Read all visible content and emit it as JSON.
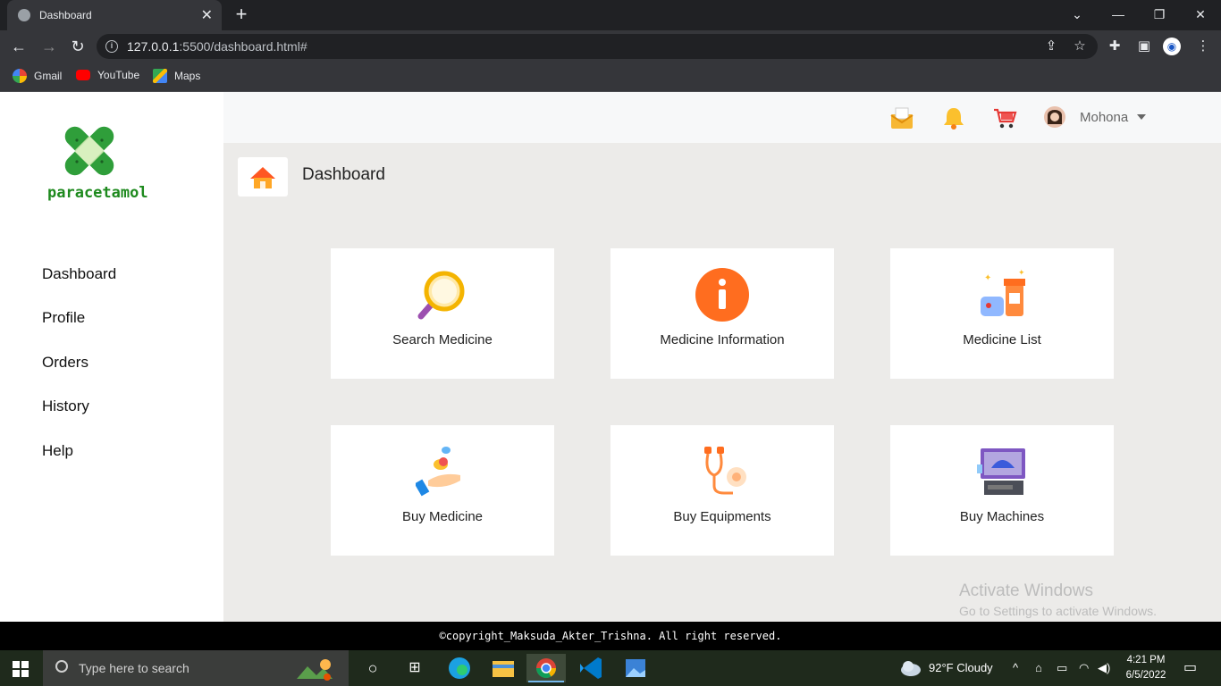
{
  "browser": {
    "tab_title": "Dashboard",
    "url_host": "127.0.0.1",
    "url_rest": ":5500/dashboard.html#",
    "bookmarks": [
      {
        "label": "Gmail",
        "icon": "google-icon"
      },
      {
        "label": "YouTube",
        "icon": "youtube-icon"
      },
      {
        "label": "Maps",
        "icon": "maps-icon"
      }
    ]
  },
  "sidebar": {
    "logo_text": "paracetamol",
    "items": [
      {
        "label": "Dashboard"
      },
      {
        "label": "Profile"
      },
      {
        "label": "Orders"
      },
      {
        "label": "History"
      },
      {
        "label": "Help"
      }
    ]
  },
  "topbar": {
    "user_name": "Mohona",
    "icons": [
      "mail-icon",
      "bell-icon",
      "cart-icon"
    ]
  },
  "breadcrumb": {
    "title": "Dashboard"
  },
  "cards": [
    {
      "label": "Search Medicine",
      "icon": "magnifier-icon"
    },
    {
      "label": "Medicine Information",
      "icon": "info-icon"
    },
    {
      "label": "Medicine List",
      "icon": "pill-bottles-icon"
    },
    {
      "label": "Buy Medicine",
      "icon": "hand-pills-icon"
    },
    {
      "label": "Buy Equipments",
      "icon": "stethoscope-icon"
    },
    {
      "label": "Buy Machines",
      "icon": "ultrasound-machine-icon"
    }
  ],
  "watermark": {
    "line1": "Activate Windows",
    "line2": "Go to Settings to activate Windows."
  },
  "footer": {
    "text": "©copyright_Maksuda_Akter_Trishna. All right reserved."
  },
  "taskbar": {
    "search_placeholder": "Type here to search",
    "weather": "92°F  Cloudy",
    "time": "4:21 PM",
    "date": "6/5/2022"
  },
  "colors": {
    "accent_orange": "#ff7a1a",
    "logo_green": "#1e8a1e",
    "page_bg": "#ecebe9"
  }
}
